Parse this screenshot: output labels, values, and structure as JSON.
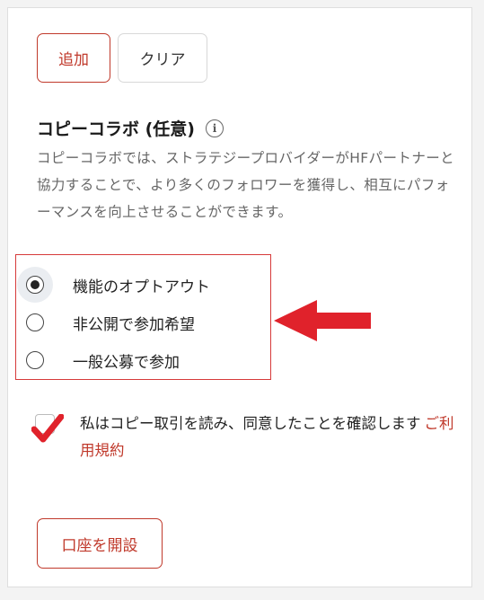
{
  "buttons": {
    "add_label": "追加",
    "clear_label": "クリア"
  },
  "copy_collab": {
    "title": "コピーコラボ (任意)",
    "info_icon_glyph": "i",
    "description": "コピーコラボでは、ストラテジープロバイダーがHFパートナーと協力することで、より多くのフォロワーを獲得し、相互にパフォーマンスを向上させることができます。",
    "options": [
      {
        "label": "機能のオプトアウト",
        "selected": true
      },
      {
        "label": "非公開で参加希望",
        "selected": false
      },
      {
        "label": "一般公募で参加",
        "selected": false
      }
    ]
  },
  "agreement": {
    "text": "私はコピー取引を読み、同意したことを確認します",
    "terms_link": "ご利用規約",
    "checked": true
  },
  "open_account_label": "口座を開設",
  "colors": {
    "accent": "#c0392b",
    "highlight_box": "#d63a3a",
    "arrow": "#e0222b"
  }
}
